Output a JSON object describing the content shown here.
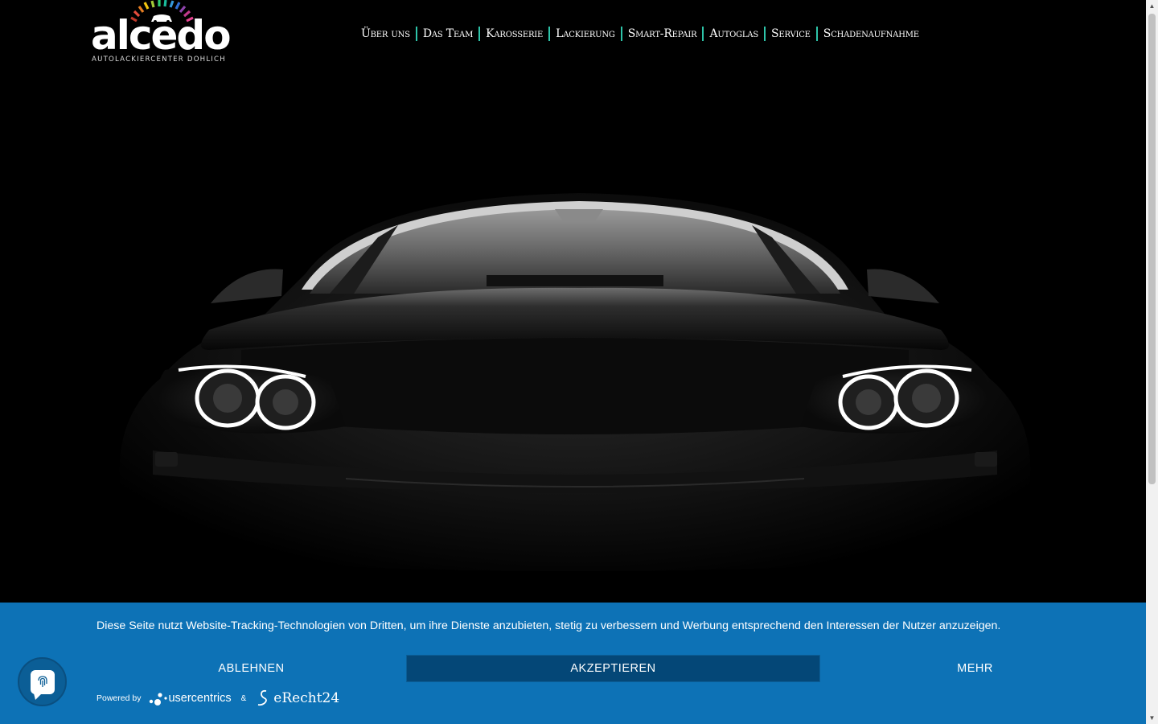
{
  "logo": {
    "wordmark": "alcedo",
    "tagline": "AUTOLACKIERCENTER DOHLICH"
  },
  "nav": {
    "items": [
      {
        "label": "Über uns"
      },
      {
        "label": "Das Team"
      },
      {
        "label": "Karosserie"
      },
      {
        "label": "Lackierung"
      },
      {
        "label": "Smart-Repair"
      },
      {
        "label": "Autoglas"
      },
      {
        "label": "Service"
      },
      {
        "label": "Schadenaufnahme"
      }
    ],
    "separator_color": "#2ec4a9"
  },
  "hero": {
    "image": "front view of black sports car with glowing headlights on black background"
  },
  "consent": {
    "text": "Diese Seite nutzt Website-Tracking-Technologien von Dritten, um ihre Dienste anzubieten, stetig zu verbessern und Werbung entsprechend den Interessen der Nutzer anzuzeigen.",
    "decline_label": "ABLEHNEN",
    "accept_label": "AKZEPTIEREN",
    "more_label": "MEHR",
    "powered_by": "Powered by",
    "usercentrics": "usercentrics",
    "amp": "&",
    "erecht": "eRecht24",
    "background_color": "#0d72b6",
    "accept_color": "#044777"
  },
  "icons": {
    "privacy_fab": "fingerprint-icon",
    "scroll_up": "arrow-up-icon",
    "scroll_down": "arrow-down-icon"
  }
}
